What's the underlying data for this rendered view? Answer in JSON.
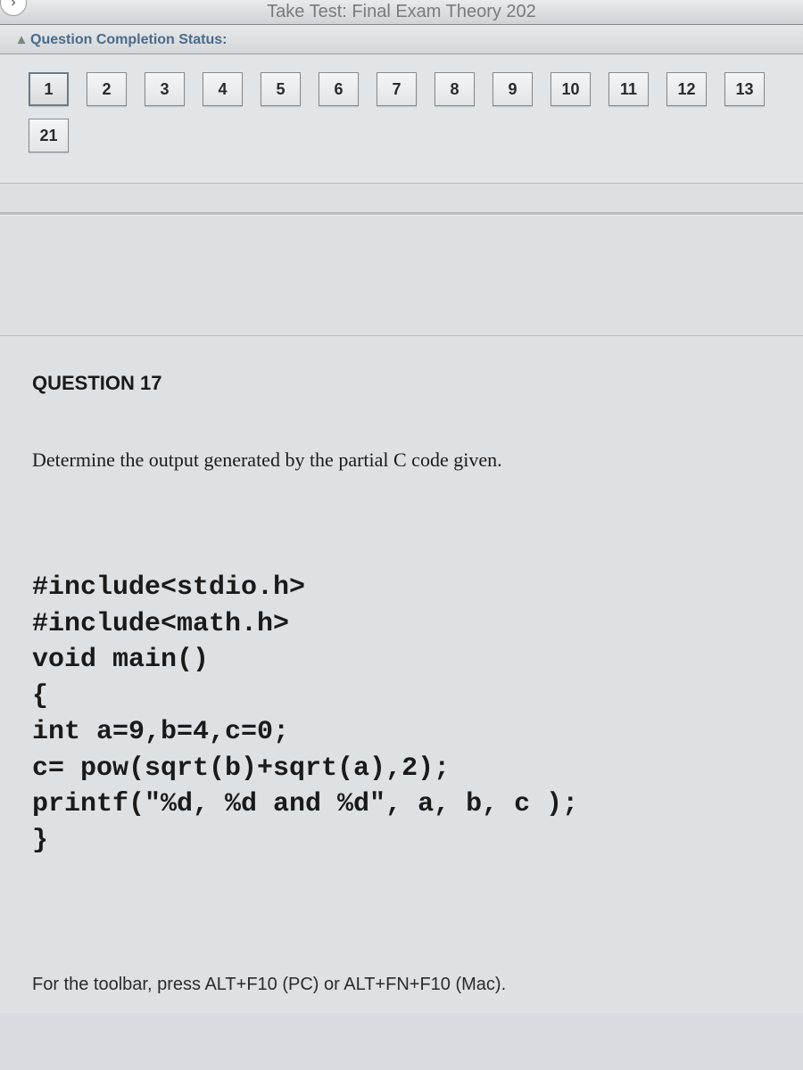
{
  "header": {
    "test_title": "Take Test: Final Exam Theory 202",
    "nav_chevron": "›"
  },
  "status": {
    "caret": "▴",
    "label": "Question Completion Status:"
  },
  "nav": {
    "row1": [
      "1",
      "2",
      "3",
      "4",
      "5",
      "6",
      "7",
      "8",
      "9",
      "10",
      "11",
      "12",
      "13"
    ],
    "row2": [
      "21"
    ]
  },
  "question": {
    "title": "QUESTION 17",
    "prompt": "Determine the output generated by the partial C code given.",
    "code": "#include<stdio.h>\n#include<math.h>\nvoid main()\n{\nint a=9,b=4,c=0;\nc= pow(sqrt(b)+sqrt(a),2);\nprintf(\"%d, %d and %d\", a, b, c );\n}",
    "toolbar_hint": "For the toolbar, press ALT+F10 (PC) or ALT+FN+F10 (Mac)."
  }
}
